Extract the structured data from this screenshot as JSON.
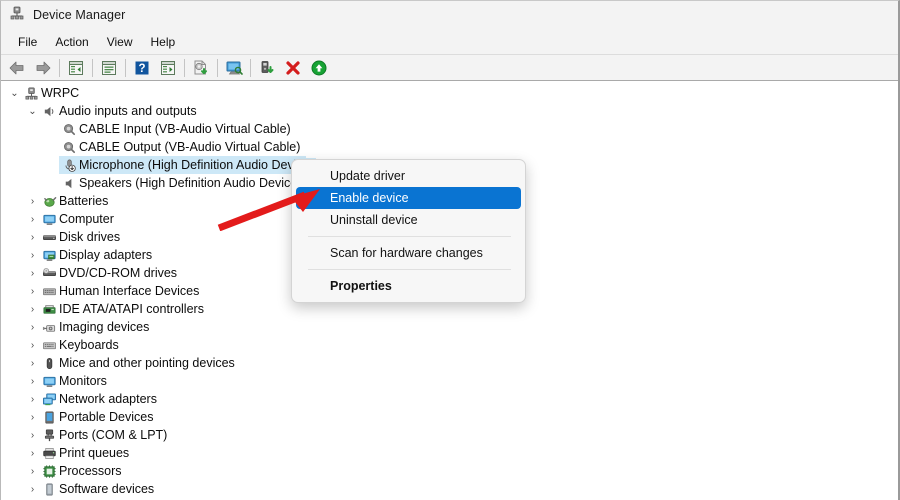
{
  "window": {
    "title": "Device Manager",
    "title_icon": "device-manager-icon"
  },
  "menubar": {
    "items": [
      {
        "label": "File"
      },
      {
        "label": "Action"
      },
      {
        "label": "View"
      },
      {
        "label": "Help"
      }
    ]
  },
  "toolbar": {
    "buttons": [
      {
        "name": "back-button",
        "icon": "back-arrow-icon"
      },
      {
        "name": "forward-button",
        "icon": "forward-arrow-icon"
      },
      {
        "name": "separator-1",
        "icon": "separator"
      },
      {
        "name": "show-hide-console-tree-button",
        "icon": "console-tree-icon"
      },
      {
        "name": "separator-2",
        "icon": "separator"
      },
      {
        "name": "properties-button",
        "icon": "properties-window-icon"
      },
      {
        "name": "separator-3",
        "icon": "separator"
      },
      {
        "name": "help-button",
        "icon": "help-question-icon"
      },
      {
        "name": "show-hide-action-pane-button",
        "icon": "action-pane-icon"
      },
      {
        "name": "separator-4",
        "icon": "separator"
      },
      {
        "name": "update-driver-button",
        "icon": "update-driver-icon"
      },
      {
        "name": "separator-5",
        "icon": "separator"
      },
      {
        "name": "scan-hardware-changes-button",
        "icon": "scan-monitor-icon"
      },
      {
        "name": "separator-6",
        "icon": "separator"
      },
      {
        "name": "add-legacy-hardware-button",
        "icon": "add-hardware-icon"
      },
      {
        "name": "uninstall-device-button",
        "icon": "red-x-icon"
      },
      {
        "name": "enable-device-button",
        "icon": "green-up-arrow-icon"
      }
    ]
  },
  "tree": {
    "nodes": [
      {
        "label": "WRPC",
        "indent": 0,
        "chevron": "expanded",
        "icon": "computer-node-icon",
        "selected": false
      },
      {
        "label": "Audio inputs and outputs",
        "indent": 1,
        "chevron": "expanded",
        "icon": "speaker-icon",
        "selected": false
      },
      {
        "label": "CABLE Input (VB-Audio Virtual Cable)",
        "indent": 2,
        "chevron": "none",
        "icon": "microphone-device-icon",
        "selected": false
      },
      {
        "label": "CABLE Output (VB-Audio Virtual Cable)",
        "indent": 2,
        "chevron": "none",
        "icon": "microphone-device-icon",
        "selected": false
      },
      {
        "label": "Microphone (High Definition Audio Device)",
        "indent": 2,
        "chevron": "none",
        "icon": "microphone-disabled-icon",
        "selected": true
      },
      {
        "label": "Speakers (High Definition Audio Device)",
        "indent": 2,
        "chevron": "none",
        "icon": "speaker-icon",
        "selected": false
      },
      {
        "label": "Batteries",
        "indent": 1,
        "chevron": "collapsed",
        "icon": "battery-category-icon",
        "selected": false
      },
      {
        "label": "Computer",
        "indent": 1,
        "chevron": "collapsed",
        "icon": "computer-category-icon",
        "selected": false
      },
      {
        "label": "Disk drives",
        "indent": 1,
        "chevron": "collapsed",
        "icon": "disk-drive-icon",
        "selected": false
      },
      {
        "label": "Display adapters",
        "indent": 1,
        "chevron": "collapsed",
        "icon": "display-adapter-icon",
        "selected": false
      },
      {
        "label": "DVD/CD-ROM drives",
        "indent": 1,
        "chevron": "collapsed",
        "icon": "dvd-drive-icon",
        "selected": false
      },
      {
        "label": "Human Interface Devices",
        "indent": 1,
        "chevron": "collapsed",
        "icon": "hid-icon",
        "selected": false
      },
      {
        "label": "IDE ATA/ATAPI controllers",
        "indent": 1,
        "chevron": "collapsed",
        "icon": "ide-controller-icon",
        "selected": false
      },
      {
        "label": "Imaging devices",
        "indent": 1,
        "chevron": "collapsed",
        "icon": "imaging-camera-icon",
        "selected": false
      },
      {
        "label": "Keyboards",
        "indent": 1,
        "chevron": "collapsed",
        "icon": "keyboard-icon",
        "selected": false
      },
      {
        "label": "Mice and other pointing devices",
        "indent": 1,
        "chevron": "collapsed",
        "icon": "mouse-icon",
        "selected": false
      },
      {
        "label": "Monitors",
        "indent": 1,
        "chevron": "collapsed",
        "icon": "monitor-icon",
        "selected": false
      },
      {
        "label": "Network adapters",
        "indent": 1,
        "chevron": "collapsed",
        "icon": "network-adapter-icon",
        "selected": false
      },
      {
        "label": "Portable Devices",
        "indent": 1,
        "chevron": "collapsed",
        "icon": "portable-device-icon",
        "selected": false
      },
      {
        "label": "Ports (COM & LPT)",
        "indent": 1,
        "chevron": "collapsed",
        "icon": "port-connector-icon",
        "selected": false
      },
      {
        "label": "Print queues",
        "indent": 1,
        "chevron": "collapsed",
        "icon": "printer-icon",
        "selected": false
      },
      {
        "label": "Processors",
        "indent": 1,
        "chevron": "collapsed",
        "icon": "processor-chip-icon",
        "selected": false
      },
      {
        "label": "Software devices",
        "indent": 1,
        "chevron": "collapsed",
        "icon": "software-device-icon",
        "selected": false
      }
    ]
  },
  "context_menu": {
    "items": [
      {
        "label": "Update driver",
        "type": "item",
        "highlight": false,
        "bold": false
      },
      {
        "label": "Enable device",
        "type": "item",
        "highlight": true,
        "bold": false
      },
      {
        "label": "Uninstall device",
        "type": "item",
        "highlight": false,
        "bold": false
      },
      {
        "label": "",
        "type": "separator",
        "highlight": false,
        "bold": false
      },
      {
        "label": "Scan for hardware changes",
        "type": "item",
        "highlight": false,
        "bold": false
      },
      {
        "label": "",
        "type": "separator",
        "highlight": false,
        "bold": false
      },
      {
        "label": "Properties",
        "type": "item",
        "highlight": false,
        "bold": true
      }
    ]
  },
  "annotation": {
    "arrow": "red-pointer-arrow",
    "points_to": "Enable device"
  },
  "colors": {
    "chrome": "#f3f3f3",
    "menu_highlight": "#0a74d2",
    "tree_selection": "#cde8f7",
    "annotation_red": "#e31b1b",
    "toolbar_green": "#1e9e3c"
  }
}
